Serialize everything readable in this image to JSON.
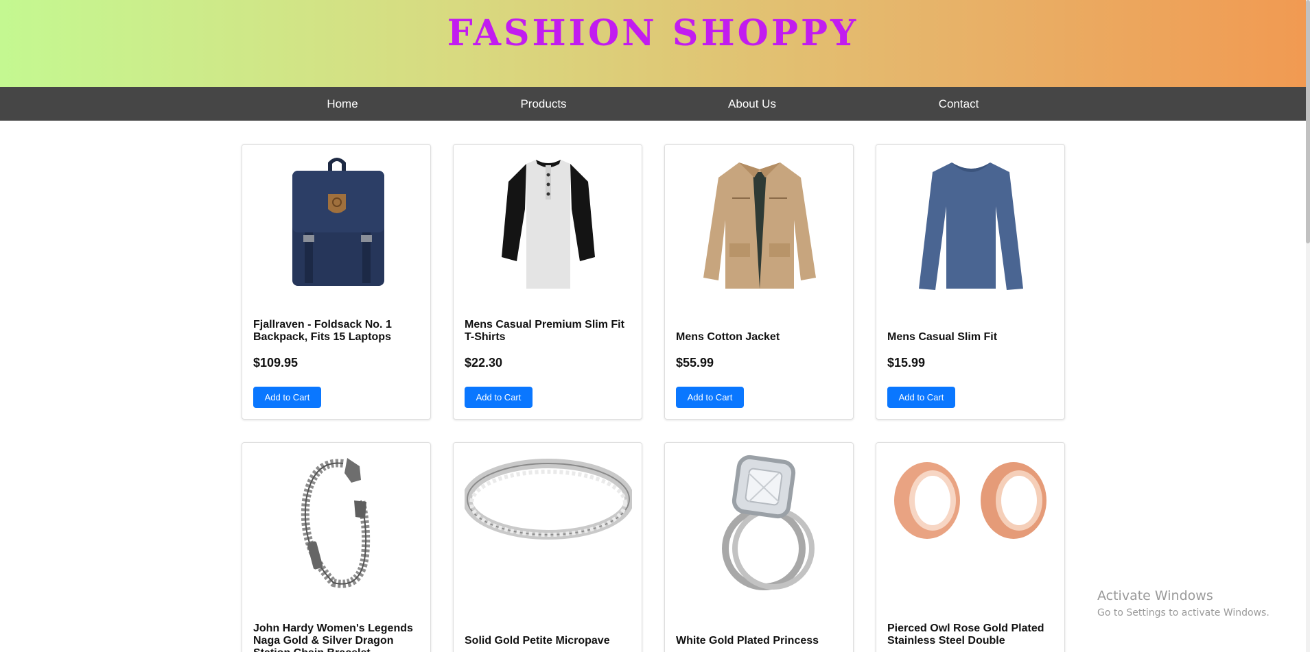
{
  "brand": {
    "title": "FASHION SHOPPY"
  },
  "nav": {
    "items": [
      {
        "label": "Home"
      },
      {
        "label": "Products"
      },
      {
        "label": "About Us"
      },
      {
        "label": "Contact"
      }
    ]
  },
  "products": [
    {
      "title": "Fjallraven - Foldsack No. 1 Backpack, Fits 15 Laptops",
      "price": "$109.95",
      "button": "Add to Cart",
      "image": "backpack-icon"
    },
    {
      "title": "Mens Casual Premium Slim Fit T-Shirts",
      "price": "$22.30",
      "button": "Add to Cart",
      "image": "tshirt-icon"
    },
    {
      "title": "Mens Cotton Jacket",
      "price": "$55.99",
      "button": "Add to Cart",
      "image": "jacket-icon"
    },
    {
      "title": "Mens Casual Slim Fit",
      "price": "$15.99",
      "button": "Add to Cart",
      "image": "longsleeve-icon"
    },
    {
      "title": "John Hardy Women's Legends Naga Gold & Silver Dragon Station Chain Bracelet",
      "image": "bracelet-icon"
    },
    {
      "title": "Solid Gold Petite Micropave",
      "image": "ring-icon"
    },
    {
      "title": "White Gold Plated Princess",
      "image": "engagement-ring-icon"
    },
    {
      "title": "Pierced Owl Rose Gold Plated Stainless Steel Double",
      "image": "earring-tunnels-icon"
    }
  ],
  "colors": {
    "brand_text": "#c21cf0",
    "nav_bg": "#464646",
    "button_bg": "#0a77ff",
    "header_gradient_start": "#c4f891",
    "header_gradient_end": "#f19a52"
  },
  "watermark": {
    "title": "Activate Windows",
    "subtitle": "Go to Settings to activate Windows."
  }
}
